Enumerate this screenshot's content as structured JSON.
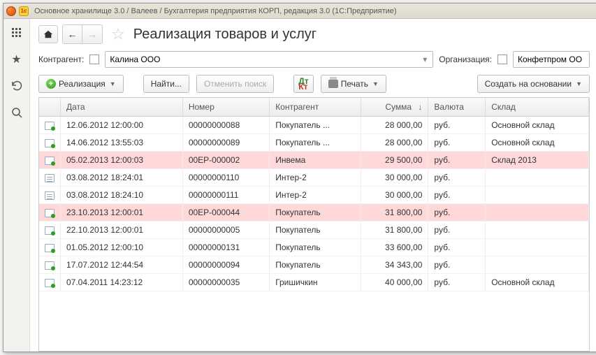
{
  "titlebar": {
    "caption": "Основное хранилище 3.0 / Валеев / Бухгалтерия предприятия КОРП, редакция 3.0  (1С:Предприятие)"
  },
  "header": {
    "page_title": "Реализация товаров и услуг"
  },
  "filter": {
    "contractor_label": "Контрагент:",
    "contractor_value": "Калина ООО",
    "org_label": "Организация:",
    "org_value": "Конфетпром ОО"
  },
  "toolbar": {
    "create_label": "Реализация",
    "find_label": "Найти...",
    "cancel_find_label": "Отменить поиск",
    "print_label": "Печать",
    "create_based_label": "Создать на основании"
  },
  "columns": {
    "date": "Дата",
    "number": "Номер",
    "contractor": "Контрагент",
    "sum": "Сумма",
    "sort_indicator": "↓",
    "currency": "Валюта",
    "warehouse": "Склад"
  },
  "rows": [
    {
      "icon": "check",
      "hl": false,
      "date": "12.06.2012 12:00:00",
      "number": "00000000088",
      "contractor": "Покупатель ...",
      "sum": "28 000,00",
      "currency": "руб.",
      "warehouse": "Основной склад"
    },
    {
      "icon": "check",
      "hl": false,
      "date": "14.06.2012 13:55:03",
      "number": "00000000089",
      "contractor": "Покупатель ...",
      "sum": "28 000,00",
      "currency": "руб.",
      "warehouse": "Основной склад"
    },
    {
      "icon": "check",
      "hl": true,
      "date": "05.02.2013 12:00:03",
      "number": "00ЕР-000002",
      "contractor": "Инвема",
      "sum": "29 500,00",
      "currency": "руб.",
      "warehouse": "Склад 2013"
    },
    {
      "icon": "lines",
      "hl": false,
      "date": "03.08.2012 18:24:01",
      "number": "00000000110",
      "contractor": "Интер-2",
      "sum": "30 000,00",
      "currency": "руб.",
      "warehouse": ""
    },
    {
      "icon": "lines",
      "hl": false,
      "date": "03.08.2012 18:24:10",
      "number": "00000000111",
      "contractor": "Интер-2",
      "sum": "30 000,00",
      "currency": "руб.",
      "warehouse": ""
    },
    {
      "icon": "check",
      "hl": true,
      "date": "23.10.2013 12:00:01",
      "number": "00ЕР-000044",
      "contractor": "Покупатель",
      "sum": "31 800,00",
      "currency": "руб.",
      "warehouse": ""
    },
    {
      "icon": "check",
      "hl": false,
      "date": "22.10.2013 12:00:01",
      "number": "00000000005",
      "contractor": "Покупатель",
      "sum": "31 800,00",
      "currency": "руб.",
      "warehouse": ""
    },
    {
      "icon": "check",
      "hl": false,
      "date": "01.05.2012 12:00:10",
      "number": "00000000131",
      "contractor": "Покупатель",
      "sum": "33 600,00",
      "currency": "руб.",
      "warehouse": ""
    },
    {
      "icon": "check",
      "hl": false,
      "date": "17.07.2012 12:44:54",
      "number": "00000000094",
      "contractor": "Покупатель",
      "sum": "34 343,00",
      "currency": "руб.",
      "warehouse": ""
    },
    {
      "icon": "check",
      "hl": false,
      "date": "07.04.2011 14:23:12",
      "number": "00000000035",
      "contractor": "Гришичкин",
      "sum": "40 000,00",
      "currency": "руб.",
      "warehouse": "Основной склад"
    }
  ]
}
